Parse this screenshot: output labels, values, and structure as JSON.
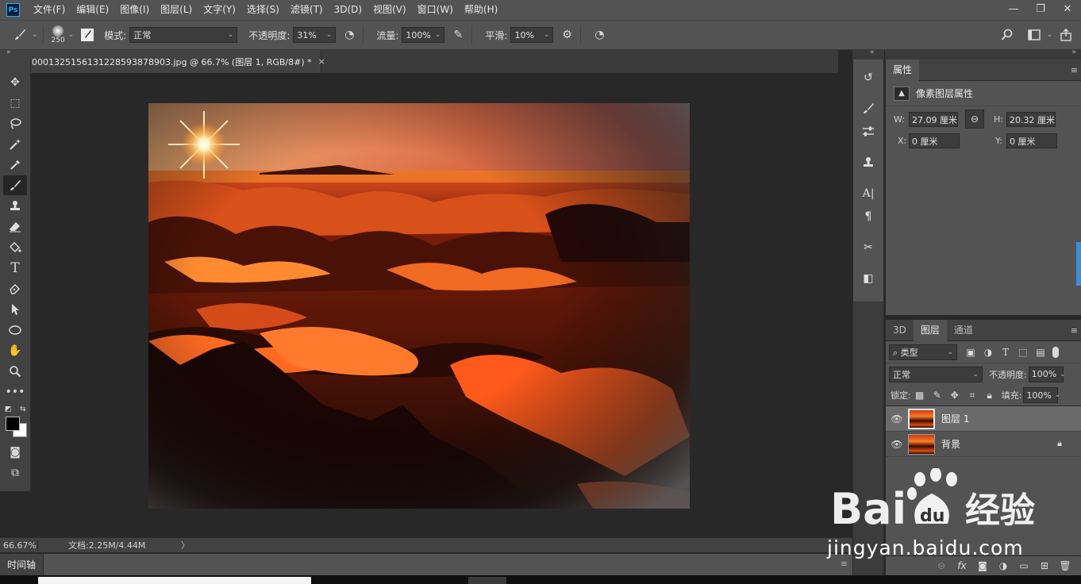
{
  "app": {
    "logo": "Ps"
  },
  "menu": [
    "文件(F)",
    "编辑(E)",
    "图像(I)",
    "图层(L)",
    "文字(Y)",
    "选择(S)",
    "滤镜(T)",
    "3D(D)",
    "视图(V)",
    "窗口(W)",
    "帮助(H)"
  ],
  "window_controls": {
    "minimize": "—",
    "restore": "❐",
    "close": "✕"
  },
  "options": {
    "brush_size": "250",
    "mode_label": "模式:",
    "mode_value": "正常",
    "opacity_label": "不透明度:",
    "opacity_value": "31%",
    "flow_label": "流量:",
    "flow_value": "100%",
    "smoothing_label": "平滑:",
    "smoothing_value": "10%"
  },
  "document": {
    "tab_title": "00013251561312285938789​03.jpg @ 66.7% (图层 1, RGB/8#) *",
    "close": "×"
  },
  "status": {
    "zoom": "66.67%",
    "doc_info": "文档:2.25M/4.44M",
    "arrow": "〉"
  },
  "timeline": {
    "tab": "时间轴"
  },
  "properties": {
    "tab": "属性",
    "heading": "像素图层属性",
    "w_label": "W:",
    "w_value": "27.09 厘米",
    "h_label": "H:",
    "h_value": "20.32 厘米",
    "x_label": "X:",
    "x_value": "0 厘米",
    "y_label": "Y:",
    "y_value": "0 厘米"
  },
  "layers_panel": {
    "tabs": [
      "3D",
      "图层",
      "通道"
    ],
    "filter_value": "类型",
    "blend_mode": "正常",
    "opacity_label": "不透明度:",
    "opacity_value": "100%",
    "lock_label": "锁定:",
    "fill_label": "填充:",
    "fill_value": "100%",
    "layers": [
      {
        "name": "图层 1",
        "selected": true
      },
      {
        "name": "背景",
        "locked": true
      }
    ]
  },
  "watermark": {
    "logo_text": "Bai du 经验",
    "url": "jingyan.baidu.com"
  },
  "icons": {
    "toolbar": [
      "move-icon",
      "marquee-icon",
      "lasso-icon",
      "magic-wand-icon",
      "eyedropper-icon",
      "brush-icon",
      "stamp-icon",
      "eraser-icon",
      "paint-bucket-icon",
      "type-icon",
      "pen-icon",
      "path-select-icon",
      "ellipse-icon",
      "hand-icon",
      "zoom-icon",
      "more-icon"
    ]
  }
}
